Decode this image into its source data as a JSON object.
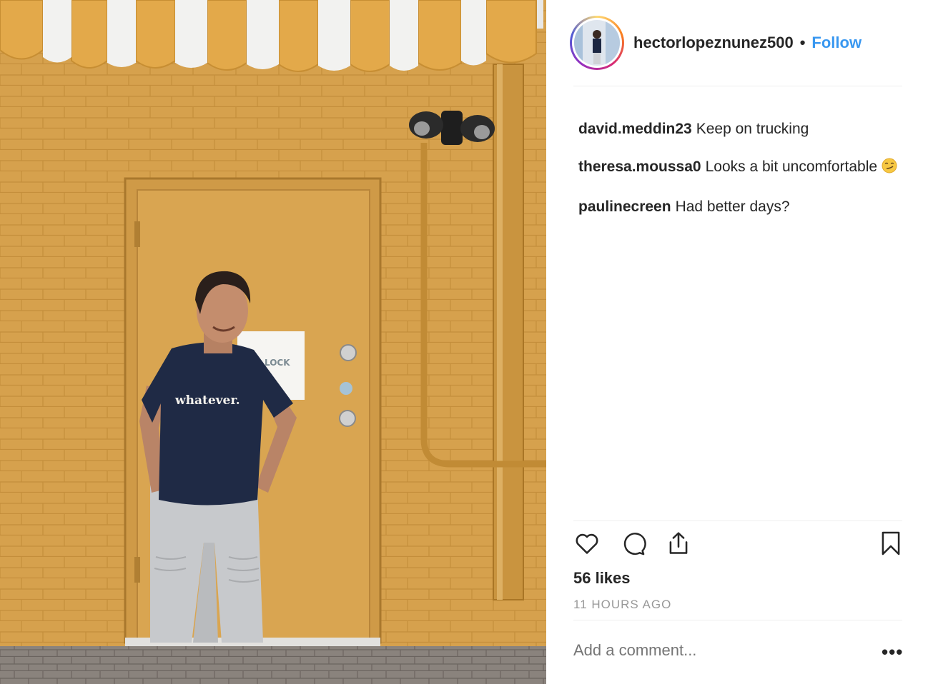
{
  "post": {
    "username": "hectorlopeznunez500",
    "separator": "•",
    "follow_label": "Follow",
    "photo_shirt_text": "whatever.",
    "photo_sign_text": "LOCK"
  },
  "comments": [
    {
      "user": "david.meddin23",
      "text": "Keep on trucking",
      "emoji": ""
    },
    {
      "user": "theresa.moussa0",
      "text": "Looks a bit uncomfortable",
      "emoji": "smirk-emoji"
    },
    {
      "user": "paulinecreen",
      "text": "Had better days?",
      "emoji": ""
    }
  ],
  "actions": {
    "icons": [
      "heart-icon",
      "comment-icon",
      "share-icon",
      "bookmark-icon"
    ]
  },
  "likes_text": "56 likes",
  "timestamp": "11 HOURS AGO",
  "add_comment": {
    "placeholder": "Add a comment..."
  },
  "more_label": "•••",
  "colors": {
    "accent": "#3897f0",
    "text": "#262626",
    "muted": "#999999",
    "wall": "#d7a24e"
  }
}
